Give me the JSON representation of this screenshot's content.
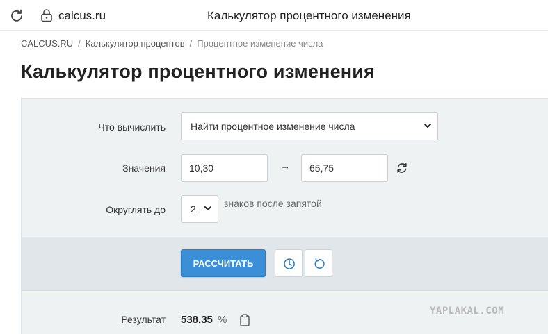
{
  "browser": {
    "url": "calcus.ru",
    "tab_title": "Калькулятор процентного изменения"
  },
  "breadcrumb": {
    "items": [
      "CALCUS.RU",
      "Калькулятор процентов",
      "Процентное изменение числа"
    ],
    "separator": "/"
  },
  "page": {
    "title": "Калькулятор процентного изменения"
  },
  "form": {
    "mode_label": "Что вычислить",
    "mode_value": "Найти процентное изменение числа",
    "values_label": "Значения",
    "value_from": "10,30",
    "arrow": "→",
    "value_to": "65,75",
    "round_label": "Округлять до",
    "round_value": "2",
    "round_hint": "знаков после запятой"
  },
  "actions": {
    "calculate_label": "РАССЧИТАТЬ"
  },
  "result": {
    "label": "Результат",
    "value": "538.35",
    "unit": "%"
  },
  "watermark": "YAPLAKAL.COM",
  "colors": {
    "accent": "#3a8fd6",
    "panel_bg": "#eef2f3",
    "band_bg": "#e0e6e9"
  },
  "icons": [
    "reload-icon",
    "lock-icon",
    "chevron-down-icon",
    "swap-icon",
    "history-icon",
    "reset-icon",
    "copy-icon"
  ]
}
